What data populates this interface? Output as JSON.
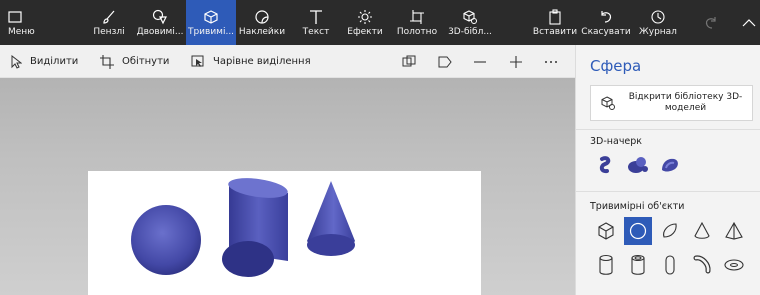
{
  "toolbar": {
    "items": [
      {
        "label": "Меню",
        "icon": "menu-window-icon"
      },
      {
        "label": "Пензлі",
        "icon": "brush-icon"
      },
      {
        "label": "Двовимі...",
        "icon": "2d-shapes-icon"
      },
      {
        "label": "Тривимі...",
        "icon": "3d-cube-icon",
        "active": true
      },
      {
        "label": "Наклейки",
        "icon": "sticker-icon"
      },
      {
        "label": "Текст",
        "icon": "text-t-icon"
      },
      {
        "label": "Ефекти",
        "icon": "sun-effects-icon"
      },
      {
        "label": "Полотно",
        "icon": "canvas-crop-icon"
      },
      {
        "label": "3D-бібл...",
        "icon": "3d-library-icon"
      },
      {
        "label": "Вставити",
        "icon": "paste-icon"
      },
      {
        "label": "Скасувати",
        "icon": "undo-icon"
      },
      {
        "label": "Журнал",
        "icon": "history-icon"
      }
    ],
    "redo_icon": "redo-icon",
    "collapse_icon": "chevron-up-icon"
  },
  "subtoolbar": {
    "select_label": "Виділити",
    "crop_label": "Обітнути",
    "magic_label": "Чарівне виділення"
  },
  "panel": {
    "title": "Сфера",
    "library_button": "Відкрити бібліотеку 3D-моделей",
    "doodle_section": "3D-начерк",
    "objects_section": "Тривимірні об'єкти"
  },
  "colors": {
    "accent": "#2e5bb8",
    "toolbar_bg": "#2b2b2b",
    "shape_fill": "#3b3f98",
    "shape_light": "#6268c8"
  }
}
